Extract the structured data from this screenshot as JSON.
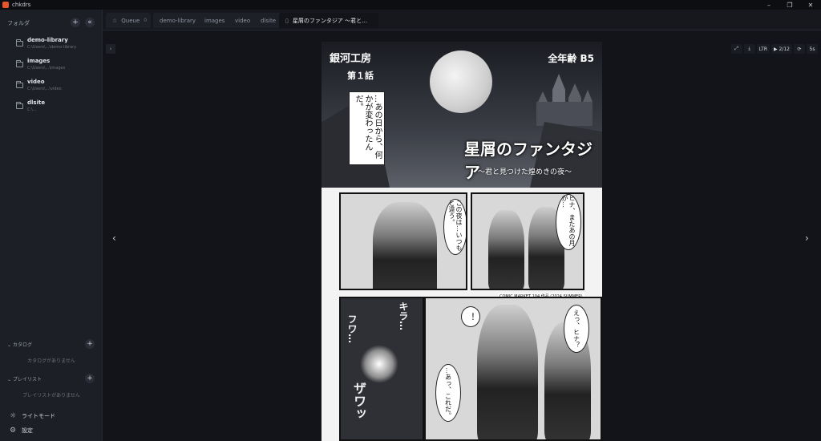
{
  "window": {
    "title": "chkdrs",
    "minimize": "–",
    "maximize": "❐",
    "close": "✕"
  },
  "sidebar": {
    "header_label": "フォルダ",
    "add_icon": "+",
    "collapse_icon": "«",
    "folders": [
      {
        "name": "demo-library",
        "path": "C:\\Users\\...\\demo-library"
      },
      {
        "name": "images",
        "path": "C:\\Users\\...\\images"
      },
      {
        "name": "video",
        "path": "C:\\Users\\...\\video"
      },
      {
        "name": "dlsite",
        "path": "C:\\..."
      }
    ],
    "catalog": {
      "label": "カタログ",
      "empty": "カタログがありません"
    },
    "playlist": {
      "label": "プレイリスト",
      "empty": "プレイリストがありません"
    },
    "footer": {
      "light_mode": "ライトモード",
      "settings": "設定"
    }
  },
  "tabs": [
    {
      "label": "Queue",
      "badge": "0"
    },
    {
      "label": "demo-library"
    },
    {
      "label": "images"
    },
    {
      "label": "video"
    },
    {
      "label": "dlsite"
    },
    {
      "label": "星屑のファンタジア ～君と…",
      "active": true
    }
  ],
  "toolbar": {
    "fullscreen": "⤢",
    "download": "⤓",
    "direction": "LTR",
    "page_indicator": "▶ 2/12",
    "loop": "⟳",
    "interval": "5s"
  },
  "viewer": {
    "prev": "‹",
    "next": "›",
    "collapse": "›"
  },
  "manga": {
    "publisher": "銀河工房",
    "chapter": "第１話",
    "rating": "全年齢 B5",
    "title_logo": "星屑のファンタジア",
    "subtitle": "〜君と見つけた煌めきの夜〜",
    "bubble_intro": "…あの日から、何かが変わったんだ。",
    "bubble_night": "この夜は…いつもと違う。",
    "bubble_hina": "ヒナ、またあの月が…",
    "credit": "COMIC MARKET 104 作品 (2024 SUMMER)",
    "sfx_kira": "キラ…",
    "sfx_fuwa": "フワ…",
    "sfx_zawa": "ザワッ",
    "bubble_exclaim": "！",
    "bubble_ehina": "えっ、ヒナ？",
    "bubble_korede": "…あっ、これだ。"
  }
}
